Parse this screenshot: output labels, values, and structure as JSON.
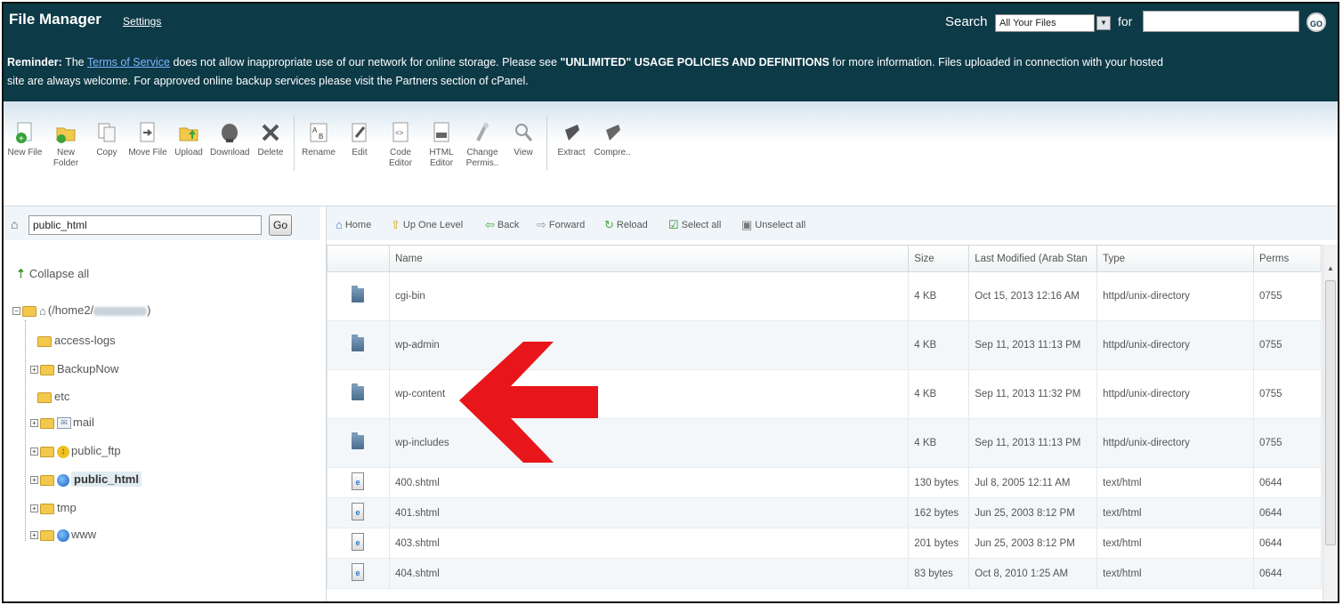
{
  "header": {
    "title": "File Manager",
    "settings_link": "Settings",
    "search_label": "Search",
    "search_scope": "All Your Files",
    "for_label": "for",
    "search_value": "",
    "go_label": "GO"
  },
  "reminder": {
    "lead": "Reminder:",
    "text1": " The ",
    "tos_link": "Terms of Service",
    "text2": " does not allow inappropriate use of our network for online storage. Please see ",
    "policy": "\"UNLIMITED\" USAGE POLICIES AND DEFINITIONS",
    "text3": " for more information. Files uploaded in connection with your hosted",
    "line2": "site are always welcome. For approved online backup services please visit the Partners section of cPanel."
  },
  "toolbar": [
    {
      "label": "New File"
    },
    {
      "label": "New Folder"
    },
    {
      "label": "Copy"
    },
    {
      "label": "Move File"
    },
    {
      "label": "Upload"
    },
    {
      "label": "Download"
    },
    {
      "label": "Delete"
    },
    {
      "label": "Rename"
    },
    {
      "label": "Edit"
    },
    {
      "label": "Code Editor"
    },
    {
      "label": "HTML Editor"
    },
    {
      "label": "Change Permis.."
    },
    {
      "label": "View"
    },
    {
      "label": "Extract"
    },
    {
      "label": "Compre.."
    }
  ],
  "left": {
    "path_value": "public_html",
    "go_label": "Go",
    "collapse_label": "Collapse all",
    "root_label": "(/home2/",
    "root_suffix": ")",
    "tree": [
      {
        "label": "access-logs"
      },
      {
        "label": "BackupNow"
      },
      {
        "label": "etc"
      },
      {
        "label": "mail"
      },
      {
        "label": "public_ftp"
      },
      {
        "label": "public_html"
      },
      {
        "label": "tmp"
      },
      {
        "label": "www"
      }
    ]
  },
  "nav": {
    "home": "Home",
    "up": "Up One Level",
    "back": "Back",
    "forward": "Forward",
    "reload": "Reload",
    "select_all": "Select all",
    "unselect_all": "Unselect all"
  },
  "table": {
    "headers": {
      "name": "Name",
      "size": "Size",
      "modified": "Last Modified (Arab Stan",
      "type": "Type",
      "perms": "Perms"
    },
    "rows": [
      {
        "name": "cgi-bin",
        "size": "4 KB",
        "modified": "Oct 15, 2013 12:16 AM",
        "type": "httpd/unix-directory",
        "perms": "0755"
      },
      {
        "name": "wp-admin",
        "size": "4 KB",
        "modified": "Sep 11, 2013 11:13 PM",
        "type": "httpd/unix-directory",
        "perms": "0755"
      },
      {
        "name": "wp-content",
        "size": "4 KB",
        "modified": "Sep 11, 2013 11:32 PM",
        "type": "httpd/unix-directory",
        "perms": "0755"
      },
      {
        "name": "wp-includes",
        "size": "4 KB",
        "modified": "Sep 11, 2013 11:13 PM",
        "type": "httpd/unix-directory",
        "perms": "0755"
      },
      {
        "name": "400.shtml",
        "size": "130 bytes",
        "modified": "Jul 8, 2005 12:11 AM",
        "type": "text/html",
        "perms": "0644"
      },
      {
        "name": "401.shtml",
        "size": "162 bytes",
        "modified": "Jun 25, 2003 8:12 PM",
        "type": "text/html",
        "perms": "0644"
      },
      {
        "name": "403.shtml",
        "size": "201 bytes",
        "modified": "Jun 25, 2003 8:12 PM",
        "type": "text/html",
        "perms": "0644"
      },
      {
        "name": "404.shtml",
        "size": "83 bytes",
        "modified": "Oct 8, 2010 1:25 AM",
        "type": "text/html",
        "perms": "0644"
      }
    ]
  },
  "colors": {
    "header_bg": "#0d3a47",
    "annotation_arrow": "#e8161a",
    "selected_bg": "#e1ecf1"
  },
  "icons": {
    "annotation": "red-left-arrow",
    "directory": "folder-icon",
    "file": "html-file-icon"
  }
}
